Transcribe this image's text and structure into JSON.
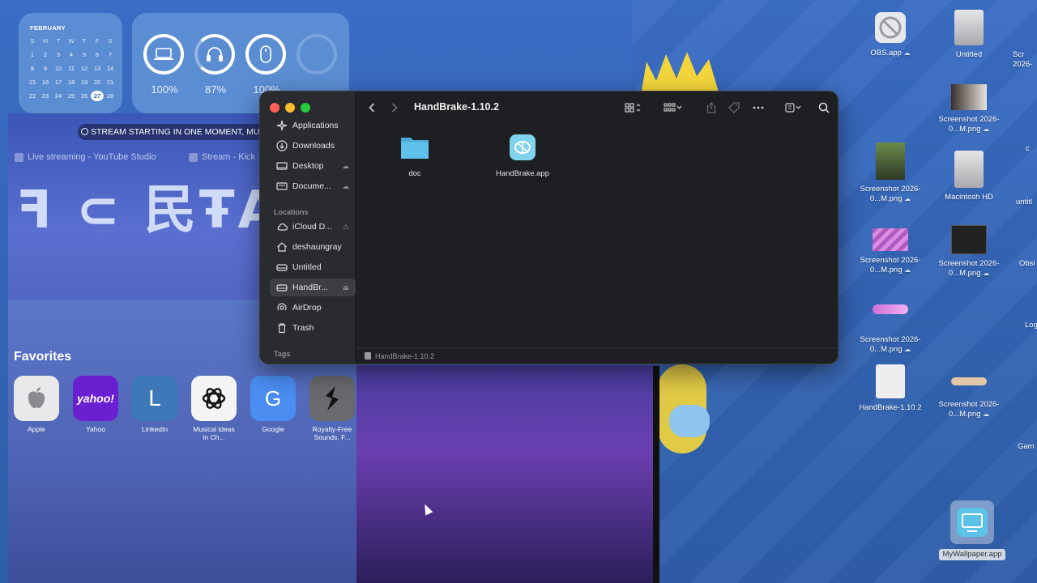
{
  "widgets": {
    "calendar": {
      "month": "FEBRUARY",
      "weekdays": [
        "S",
        "M",
        "T",
        "W",
        "T",
        "F",
        "S"
      ],
      "days": [
        "1",
        "2",
        "3",
        "4",
        "5",
        "6",
        "7",
        "8",
        "9",
        "10",
        "11",
        "12",
        "13",
        "14",
        "15",
        "16",
        "17",
        "18",
        "19",
        "20",
        "21",
        "22",
        "23",
        "24",
        "25",
        "26",
        "27",
        "28"
      ],
      "today": "27"
    },
    "batteries": [
      {
        "device": "laptop-icon",
        "level": "100%"
      },
      {
        "device": "headphones-icon",
        "level": "87%"
      },
      {
        "device": "mouse-icon",
        "level": "100%"
      }
    ]
  },
  "browser": {
    "search_text": "STREAM STARTING IN ONE MOMENT, MUC",
    "tabs": [
      "Live streaming - YouTube Studio",
      "Stream - Kick"
    ],
    "sign_text": "ꟻ ⊂ 民ŦAΓ⌐",
    "favorites_title": "Favorites",
    "favorites": [
      {
        "label": "Apple"
      },
      {
        "label": "Yahoo",
        "tile_text": "yahoo!"
      },
      {
        "label": "LinkedIn",
        "tile_text": "L"
      },
      {
        "label": "Musical ideas in Ch..."
      },
      {
        "label": "Google",
        "tile_text": "G"
      },
      {
        "label": "Royalty-Free Sounds, F..."
      }
    ]
  },
  "finder": {
    "title": "HandBrake-1.10.2",
    "sidebar_favorites": [
      {
        "label": "Applications",
        "icon": "applications-icon"
      },
      {
        "label": "Downloads",
        "icon": "downloads-icon"
      },
      {
        "label": "Desktop",
        "icon": "desktop-icon"
      },
      {
        "label": "Docume...",
        "icon": "document-icon"
      }
    ],
    "locations_header": "Locations",
    "sidebar_locations": [
      {
        "label": "iCloud D...",
        "icon": "cloud-icon"
      },
      {
        "label": "deshaungray",
        "icon": "home-icon"
      },
      {
        "label": "Untitled",
        "icon": "drive-icon"
      },
      {
        "label": "HandBr...",
        "icon": "drive-icon"
      },
      {
        "label": "AirDrop",
        "icon": "airdrop-icon"
      },
      {
        "label": "Trash",
        "icon": "trash-icon"
      }
    ],
    "tags_header": "Tags",
    "items": [
      {
        "label": "doc",
        "icon": "folder-icon"
      },
      {
        "label": "HandBrake.app",
        "icon": "handbrake-app-icon"
      }
    ],
    "path": "HandBrake-1.10.2"
  },
  "desktop": {
    "icons": [
      {
        "label": "OBS.app"
      },
      {
        "label": "Untitled"
      },
      {
        "label": "Scr 2026-"
      },
      {
        "label": "Screenshot 2026-0...M.png"
      },
      {
        "label": "Screenshot 2026-0...M.png"
      },
      {
        "label": "Macintosh HD"
      },
      {
        "label": "Screenshot 2026-0...M.png"
      },
      {
        "label": "Screenshot 2026-0...M.png"
      },
      {
        "label": "Screenshot 2026-0...M.png"
      },
      {
        "label": "HandBrake-1.10.2"
      },
      {
        "label": "Screenshot 2026-0...M.png"
      },
      {
        "label": "MyWallpaper.app"
      }
    ],
    "edge_labels": [
      "c",
      "untitl",
      "Obsi",
      "Log",
      "Gam"
    ]
  },
  "colors": {
    "desktop_bg": "#3566b8",
    "finder_bg": "#1e1f22",
    "sidebar_bg": "#2a2b2e",
    "close": "#ff5f57",
    "minimize": "#febc2e",
    "zoom": "#28c840",
    "folder_blue": "#5ec1e9"
  }
}
